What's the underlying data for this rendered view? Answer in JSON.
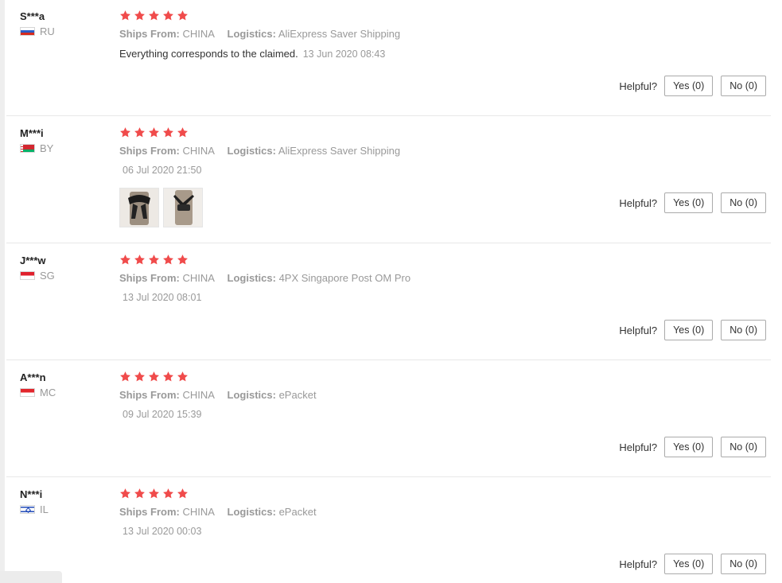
{
  "labels": {
    "ships_from": "Ships From:",
    "logistics": "Logistics:",
    "helpful": "Helpful?",
    "rating": 5
  },
  "colors": {
    "star": "#f04b4b"
  },
  "reviews": [
    {
      "user": "S***a",
      "country": "RU",
      "ships_from": "CHINA",
      "logistics": "AliExpress Saver Shipping",
      "text": "Everything corresponds to the claimed.",
      "date": "13 Jun 2020 08:43",
      "yes": "Yes (0)",
      "no": "No (0)"
    },
    {
      "user": "M***i",
      "country": "BY",
      "ships_from": "CHINA",
      "logistics": "AliExpress Saver Shipping",
      "date": "06 Jul 2020 21:50",
      "yes": "Yes (0)",
      "no": "No (0)"
    },
    {
      "user": "J***w",
      "country": "SG",
      "ships_from": "CHINA",
      "logistics": "4PX Singapore Post OM Pro",
      "date": "13 Jul 2020 08:01",
      "yes": "Yes (0)",
      "no": "No (0)"
    },
    {
      "user": "A***n",
      "country": "MC",
      "ships_from": "CHINA",
      "logistics": "ePacket",
      "date": "09 Jul 2020 15:39",
      "yes": "Yes (0)",
      "no": "No (0)"
    },
    {
      "user": "N***i",
      "country": "IL",
      "ships_from": "CHINA",
      "logistics": "ePacket",
      "date": "13 Jul 2020 00:03",
      "yes": "Yes (0)",
      "no": "No (0)"
    }
  ]
}
